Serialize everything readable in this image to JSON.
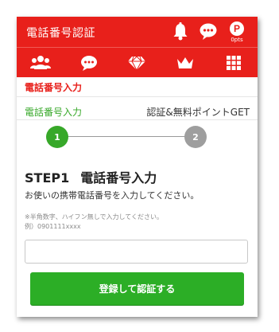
{
  "header": {
    "title": "電話番号認証",
    "points_letter": "P",
    "points_value": "0pts"
  },
  "icon_bar": [
    {
      "icon": "people-icon"
    },
    {
      "icon": "chat-bubble-icon"
    },
    {
      "icon": "diamond-icon"
    },
    {
      "icon": "crown-icon"
    },
    {
      "icon": "grid-icon"
    }
  ],
  "section_title": "電話番号入力",
  "steps": {
    "step1_label": "電話番号入力",
    "step2_label": "認証&無料ポイントGET",
    "step1_num": "1",
    "step2_num": "2"
  },
  "form": {
    "heading_step": "STEP1",
    "heading_text": "電話番号入力",
    "description": "お使いの携帯電話番号を入力してください。",
    "note_line1": "※半角数字、ハイフン無しで入力してください。",
    "note_line2": "例）0901111xxxx",
    "phone_value": "",
    "submit_label": "登録して認証する"
  },
  "colors": {
    "brand_red": "#e8201b",
    "active_green": "#37a829",
    "button_green": "#2cae26",
    "inactive_gray": "#9e9e9e"
  }
}
